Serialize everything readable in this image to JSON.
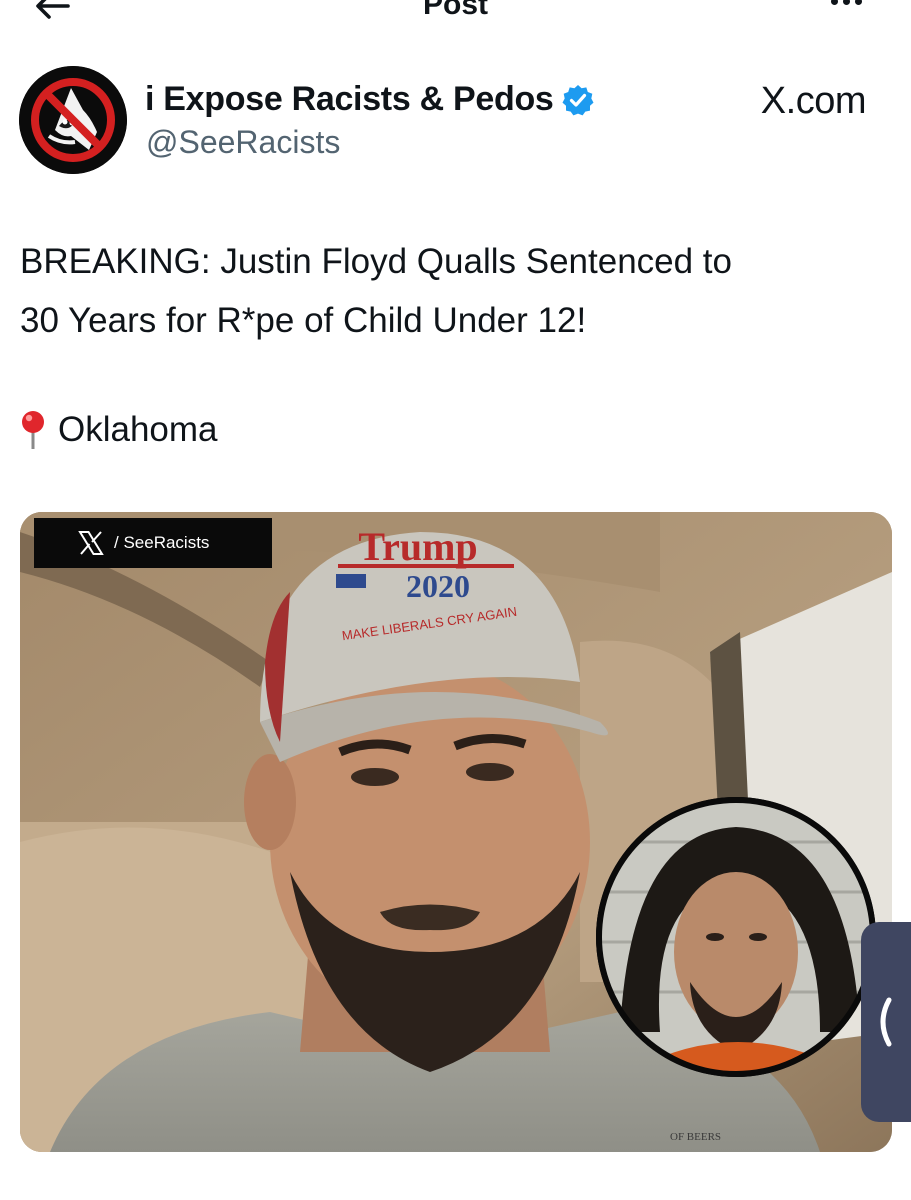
{
  "topbar": {
    "title": "Post",
    "back_icon": "arrow-left-icon",
    "more_icon": "more-horizontal-icon"
  },
  "author": {
    "display_name": "i Expose Racists & Pedos",
    "handle": "@SeeRacists",
    "verified": true,
    "verified_color": "#1d9bf0",
    "avatar_icon": "no-kkk-logo-icon",
    "source_label": "X.com"
  },
  "post": {
    "text_line1": "BREAKING: Justin Floyd Qualls Sentenced to",
    "text_line2": "30 Years for R*pe of Child Under 12!",
    "location_icon": "pin-icon",
    "location": "Oklahoma"
  },
  "media": {
    "watermark": "/ SeeRacists",
    "watermark_icon": "x-logo-icon",
    "cap_text_top": "Trump",
    "cap_text_year": "2020",
    "cap_text_slogan": "MAKE LIBERALS CRY AGAIN",
    "mug_board_text": "OF BEERS"
  },
  "side_handle": {
    "icon": "chevron-left-icon"
  }
}
